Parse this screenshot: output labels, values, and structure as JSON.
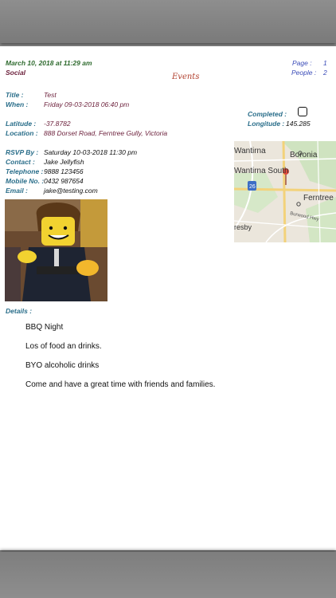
{
  "header": {
    "date_time": "March 10, 2018 at 11:29 am",
    "category": "Social",
    "title": "Events",
    "page_label": "Page :",
    "page_value": "1",
    "people_label": "People :",
    "people_value": "2"
  },
  "event": {
    "title_label": "Title :",
    "title_value": "Test",
    "when_label": "When :",
    "when_value": "Friday 09-03-2018 06:40 pm",
    "completed_label": "Completed :",
    "latitude_label": "Latitude :",
    "latitude_value": "-37.8782",
    "longitude_label": "Longitude :",
    "longitude_value": "145.285",
    "location_label": "Location :",
    "location_value": "888 Dorset Road, Ferntree Gully, Victoria",
    "rsvp_label": "RSVP By :",
    "rsvp_value": "Saturday 10-03-2018 11:30 pm",
    "contact_label": "Contact :",
    "contact_value": "Jake Jellyfish",
    "telephone_label": "Telephone :",
    "telephone_value": "9888 123456",
    "mobile_label": "Mobile No. :",
    "mobile_value": "0432 987654",
    "email_label": "Email :",
    "email_value": "jake@testing.com",
    "details_label": "Details :"
  },
  "map": {
    "labels": [
      "Wantirna",
      "Boronia",
      "Wantirna South",
      "Ferntree G",
      "Burwood Hwy",
      "resby",
      "26"
    ]
  },
  "details": [
    "BBQ Night",
    "Los of food an drinks.",
    "BYO alcoholic drinks",
    "Come and have a great time with friends and families."
  ],
  "colors": {
    "label": "#2a6e8a",
    "value": "#6b1f3a",
    "date": "#2f6b2f",
    "blue": "#3a4bb8",
    "title": "#b2412f"
  }
}
